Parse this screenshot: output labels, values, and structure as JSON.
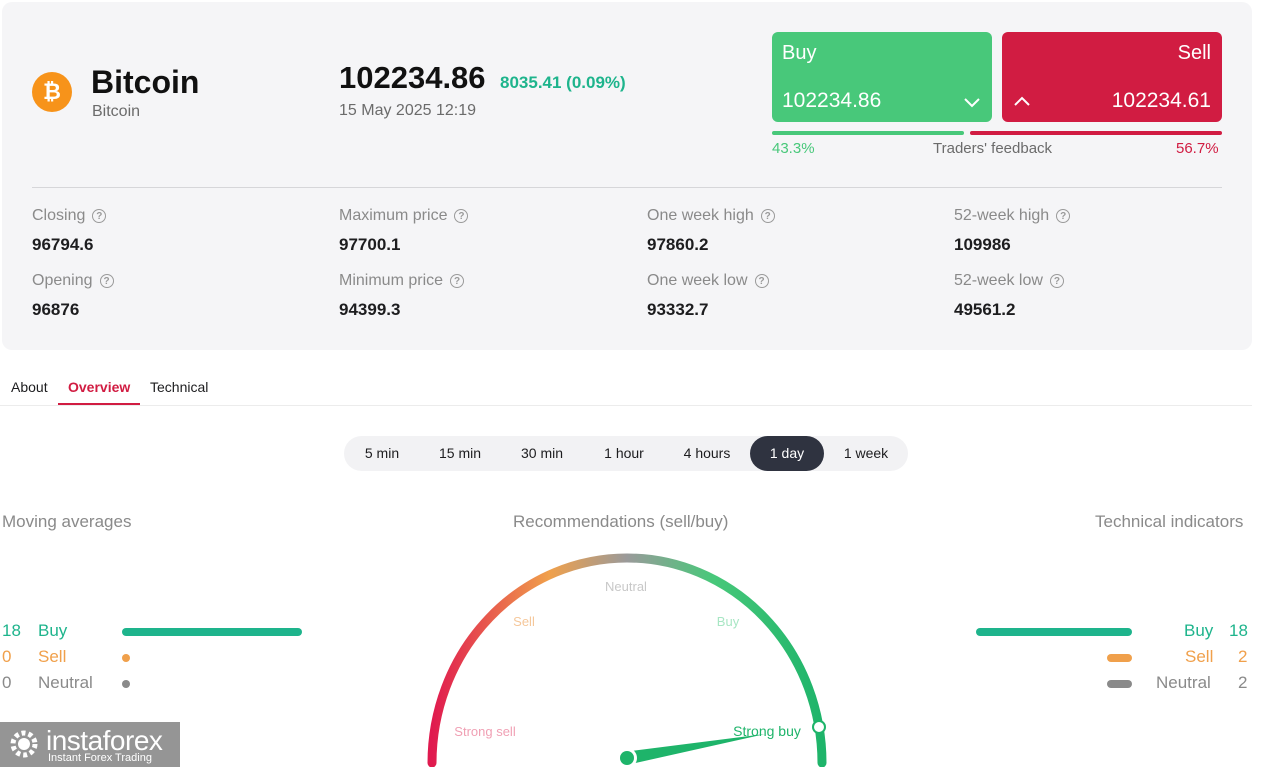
{
  "instrument": {
    "icon_symbol": "₿",
    "name": "Bitcoin",
    "subtitle": "Bitcoin",
    "price": "102234.86",
    "change": "8035.41 (0.09%)",
    "datetime": "15 May 2025 12:19"
  },
  "trade": {
    "buy_label": "Buy",
    "buy_price": "102234.86",
    "sell_label": "Sell",
    "sell_price": "102234.61"
  },
  "feedback": {
    "buy_pct": "43.3%",
    "label": "Traders' feedback",
    "sell_pct": "56.7%",
    "buy_fraction": 0.433
  },
  "stats": [
    {
      "label": "Closing",
      "value": "96794.6"
    },
    {
      "label": "Opening",
      "value": "96876"
    },
    {
      "label": "Maximum price",
      "value": "97700.1"
    },
    {
      "label": "Minimum price",
      "value": "94399.3"
    },
    {
      "label": "One week high",
      "value": "97860.2"
    },
    {
      "label": "One week low",
      "value": "93332.7"
    },
    {
      "label": "52-week high",
      "value": "109986"
    },
    {
      "label": "52-week low",
      "value": "49561.2"
    }
  ],
  "tabs": [
    {
      "label": "About",
      "active": false
    },
    {
      "label": "Overview",
      "active": true
    },
    {
      "label": "Technical",
      "active": false
    }
  ],
  "periods": [
    {
      "label": "5 min",
      "active": false
    },
    {
      "label": "15 min",
      "active": false
    },
    {
      "label": "30 min",
      "active": false
    },
    {
      "label": "1 hour",
      "active": false
    },
    {
      "label": "4 hours",
      "active": false
    },
    {
      "label": "1 day",
      "active": true
    },
    {
      "label": "1 week",
      "active": false
    }
  ],
  "sections": {
    "moving_averages": "Moving averages",
    "recommendations": "Recommendations (sell/buy)",
    "technical_indicators": "Technical indicators"
  },
  "moving_averages": [
    {
      "count": "18",
      "label": "Buy"
    },
    {
      "count": "0",
      "label": "Sell"
    },
    {
      "count": "0",
      "label": "Neutral"
    }
  ],
  "technical_indicators": [
    {
      "count": "18",
      "label": "Buy"
    },
    {
      "count": "2",
      "label": "Sell"
    },
    {
      "count": "2",
      "label": "Neutral"
    }
  ],
  "gauge": {
    "labels": {
      "strong_sell": "Strong sell",
      "sell": "Sell",
      "neutral": "Neutral",
      "buy": "Buy",
      "strong_buy": "Strong buy"
    },
    "reading": "Strong buy"
  },
  "colors": {
    "buy": "#48c87a",
    "sell": "#d11c42",
    "teal": "#1eb48c",
    "orange": "#f0a04b",
    "neutral": "#8a8a8a"
  },
  "watermark": {
    "brand": "instaforex",
    "tagline": "Instant Forex Trading"
  }
}
